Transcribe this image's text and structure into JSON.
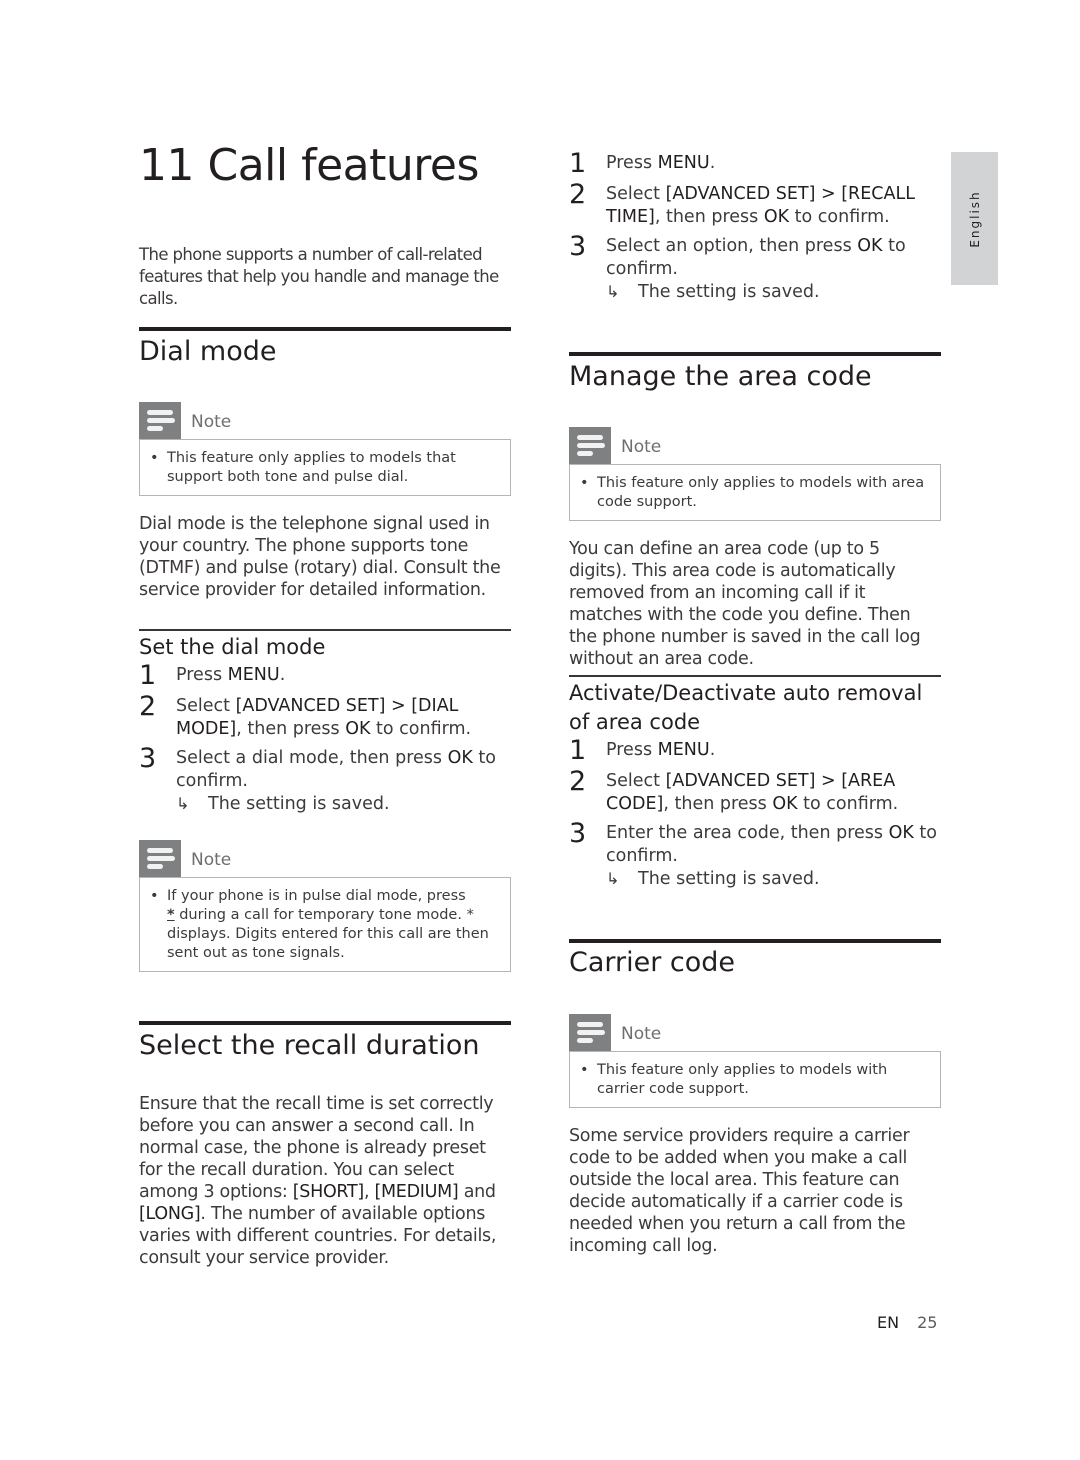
{
  "chapter": {
    "title": "11  Call features",
    "intro": "The phone supports a number of call-related features that help you handle and manage the calls."
  },
  "side_tab": {
    "label": "English"
  },
  "dial_mode": {
    "title": "Dial mode",
    "note": {
      "label": "Note",
      "text": "This feature only applies to models that support both tone and pulse dial."
    },
    "body": "Dial mode is the telephone signal used in your country. The phone supports tone (DTMF) and pulse (rotary) dial. Consult the service provider for detailed information.",
    "set_dial_mode": {
      "title": "Set the dial mode",
      "steps": [
        {
          "num": "1",
          "pre": "Press ",
          "bold1": "MENU",
          "mid": ".",
          "bold2": "",
          "post": ""
        },
        {
          "num": "2",
          "pre": "Select ",
          "bold1": "[ADVANCED SET] > [DIAL MODE]",
          "mid": ", then press ",
          "bold2": "OK",
          "post": " to confirm."
        },
        {
          "num": "3",
          "pre": "Select a dial mode, then press ",
          "bold1": "OK",
          "mid": " to confirm.",
          "bold2": "",
          "post": ""
        }
      ],
      "result": "The setting is saved."
    },
    "note2": {
      "label": "Note",
      "text_pre": " If your phone is in pulse dial mode, press",
      "key_symbol": "*",
      "text_post": " during a call for temporary tone mode. * displays. Digits entered for this call are then sent out as tone signals."
    }
  },
  "recall": {
    "title": "Select the recall duration",
    "body_pre": "Ensure that the recall time is set correctly before you can answer a second call. In normal case, the phone is already preset for the recall duration. You can select among 3 options: ",
    "opt1": "[SHORT]",
    "sep1": ", ",
    "opt2": "[MEDIUM]",
    "sep2": " and ",
    "opt3": "[LONG]",
    "body_post": ". The number of available options varies with different countries. For details, consult your service provider.",
    "steps": [
      {
        "num": "1",
        "pre": "Press ",
        "bold1": "MENU",
        "mid": ".",
        "bold2": "",
        "post": ""
      },
      {
        "num": "2",
        "pre": "Select ",
        "bold1": "[ADVANCED SET] > [RECALL TIME]",
        "mid": ", then press ",
        "bold2": "OK",
        "post": " to confirm."
      },
      {
        "num": "3",
        "pre": "Select an option, then press ",
        "bold1": "OK",
        "mid": " to confirm.",
        "bold2": "",
        "post": ""
      }
    ],
    "result": "The setting is saved."
  },
  "area_code": {
    "title": "Manage the area code",
    "note": {
      "label": "Note",
      "text": "This feature only applies to models with area code support."
    },
    "body": "You can define an area code (up to 5 digits). This area code is automatically removed from an incoming call if it matches with the code you define. Then the phone number is saved in the call log without an area code.",
    "auto_removal": {
      "title": "Activate/Deactivate auto removal of area code",
      "steps": [
        {
          "num": "1",
          "pre": "Press ",
          "bold1": "MENU",
          "mid": ".",
          "bold2": "",
          "post": ""
        },
        {
          "num": "2",
          "pre": "Select ",
          "bold1": "[ADVANCED SET] > [AREA CODE]",
          "mid": ", then press ",
          "bold2": "OK",
          "post": " to confirm."
        },
        {
          "num": "3",
          "pre": "Enter the area code, then press ",
          "bold1": "OK",
          "mid": " to confirm.",
          "bold2": "",
          "post": ""
        }
      ],
      "result": "The setting is saved."
    }
  },
  "carrier_code": {
    "title": "Carrier code",
    "note": {
      "label": "Note",
      "text": "This feature only applies to models with carrier code support."
    },
    "body": "Some service providers require a carrier code to be added when you make a call outside the local area. This feature can decide automatically if a carrier code is needed when you return a call from the incoming call log."
  },
  "footer": {
    "lang": "EN",
    "page": "25"
  }
}
